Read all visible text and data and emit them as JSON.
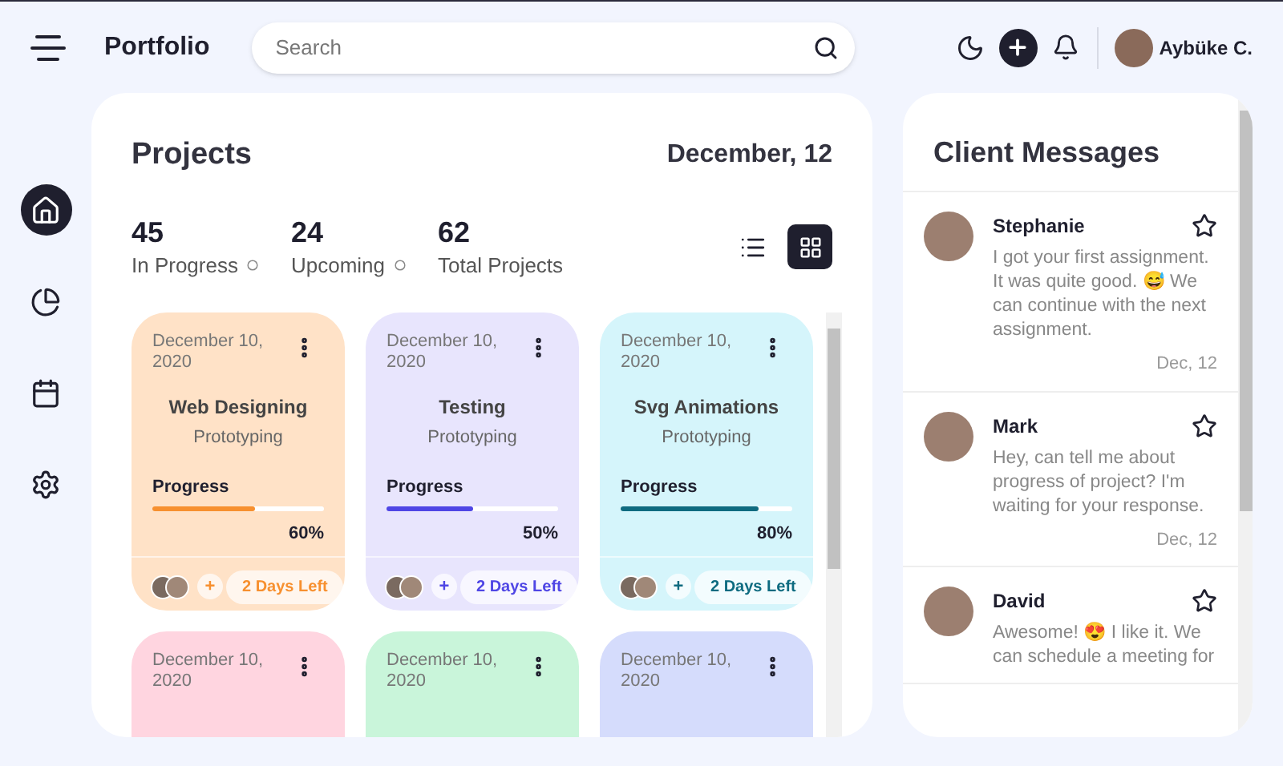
{
  "header": {
    "brand": "Portfolio",
    "search": {
      "placeholder": "Search"
    },
    "user": {
      "name": "Aybüke C."
    }
  },
  "sidebar": {
    "items": [
      {
        "kind": "home",
        "selected": true
      },
      {
        "kind": "chart",
        "selected": false
      },
      {
        "kind": "calendar",
        "selected": false
      },
      {
        "kind": "settings",
        "selected": false
      }
    ]
  },
  "projects": {
    "title": "Projects",
    "date": "December, 12",
    "stats": [
      {
        "value": "45",
        "label": "In Progress",
        "marker": true
      },
      {
        "value": "24",
        "label": "Upcoming",
        "marker": true
      },
      {
        "value": "62",
        "label": "Total Projects",
        "marker": false
      }
    ],
    "view_toggle": [
      {
        "kind": "list",
        "selected": false
      },
      {
        "kind": "grid",
        "selected": true
      }
    ],
    "cards": [
      {
        "kind": "orange",
        "date": "December 10, 2020",
        "title": "Web Designing",
        "subtitle": "Prototyping",
        "progress_label": "Progress",
        "level": 0.6,
        "percent": "60%",
        "add": "+",
        "days_left": "2 Days Left"
      },
      {
        "kind": "purple",
        "date": "December 10, 2020",
        "title": "Testing",
        "subtitle": "Prototyping",
        "progress_label": "Progress",
        "level": 0.5,
        "percent": "50%",
        "add": "+",
        "days_left": "2 Days Left"
      },
      {
        "kind": "cyan",
        "date": "December 10, 2020",
        "title": "Svg Animations",
        "subtitle": "Prototyping",
        "progress_label": "Progress",
        "level": 0.8,
        "percent": "80%",
        "add": "+",
        "days_left": "2 Days Left"
      },
      {
        "kind": "pink",
        "date": "December 10, 2020"
      },
      {
        "kind": "green",
        "date": "December 10, 2020"
      },
      {
        "kind": "blue",
        "date": "December 10, 2020"
      }
    ]
  },
  "messages": {
    "title": "Client Messages",
    "items": [
      {
        "name": "Stephanie",
        "text": "I got your first assignment. It was quite good. 😅 We can continue with the next assignment.",
        "date": "Dec, 12",
        "starred": false
      },
      {
        "name": "Mark",
        "text": "Hey, can tell me about progress of project? I'm waiting for your response.",
        "date": "Dec, 12",
        "starred": false
      },
      {
        "name": "David",
        "text": "Awesome! 😍 I like it. We can schedule a meeting for",
        "starred": false
      }
    ]
  }
}
